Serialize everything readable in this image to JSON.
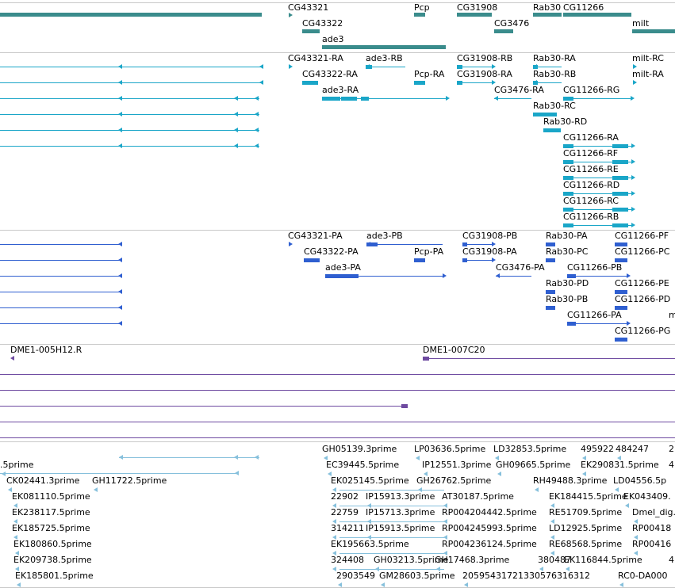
{
  "colors": {
    "gene": "#3a8c8c",
    "transcript": "#1aa6c8",
    "protein": "#2f5fd0",
    "clone": "#6e4aa0",
    "est": "#86c0dc",
    "separator": "#c8c8c8"
  },
  "tracks": {
    "genes": {
      "labels": [
        "CG43321",
        "Pcp",
        "CG31908",
        "Rab30",
        "CG11266",
        "CG43322",
        "CG3476",
        "milt",
        "ade3"
      ]
    },
    "transcripts": {
      "labels": [
        "CG43321-RA",
        "ade3-RB",
        "CG31908-RB",
        "Rab30-RA",
        "milt-RC",
        "CG43322-RA",
        "Pcp-RA",
        "CG31908-RA",
        "Rab30-RB",
        "milt-RA",
        "ade3-RA",
        "CG3476-RA",
        "CG11266-RG",
        "Rab30-RC",
        "Rab30-RD",
        "CG11266-RA",
        "CG11266-RF",
        "CG11266-RE",
        "CG11266-RD",
        "CG11266-RC",
        "CG11266-RB"
      ]
    },
    "proteins": {
      "labels": [
        "CG43321-PA",
        "ade3-PB",
        "CG31908-PB",
        "Rab30-PA",
        "CG11266-PF",
        "CG43322-PA",
        "Pcp-PA",
        "CG31908-PA",
        "Rab30-PC",
        "CG11266-PC",
        "ade3-PA",
        "CG3476-PA",
        "CG11266-PB",
        "Rab30-PD",
        "CG11266-PE",
        "Rab30-PB",
        "CG11266-PD",
        "CG11266-PA",
        "m",
        "CG11266-PG"
      ]
    },
    "clones": {
      "labels": [
        "DME1-005H12.R",
        "DME1-007C20"
      ]
    },
    "ests": {
      "labels": [
        "GH05139.3prime",
        "LP03636.5prime",
        "LD32853.5prime",
        "495922",
        "484247",
        "2",
        ".5prime",
        "EC39445.5prime",
        "IP12551.3prime",
        "GH09665.5prime",
        "EK290831.5prime",
        "4",
        "CK02441.3prime",
        "GH11722.5prime",
        "EK025145.5prime",
        "GH26762.5prime",
        "RH49488.3prime",
        "LD04556.5p",
        "EK081110.5prime",
        "22902",
        "IP15913.3prime",
        "AT30187.5prime",
        "EK184415.5prime",
        "EK043409.",
        "EK238117.5prime",
        "22759",
        "IP15713.3prime",
        "RP004204442.5prime",
        "RE51709.5prime",
        "Dmel_dig.",
        "EK185725.5prime",
        "314211",
        "IP15913.5prime",
        "RP004245993.5prime",
        "LD12925.5prime",
        "RP00418",
        "EK180860.5prime",
        "EK195663.5prime",
        "RP004236124.5prime",
        "RE68568.5prime",
        "RP00416",
        "EK209738.5prime",
        "324408",
        "GH03213.5prime",
        "GH17468.3prime",
        "380487",
        "EK116844.5prime",
        "4",
        "EK185801.5prime",
        "2903549",
        "GM28603.5prime",
        "20595431721330576316312",
        "RC0-DA000"
      ]
    }
  }
}
